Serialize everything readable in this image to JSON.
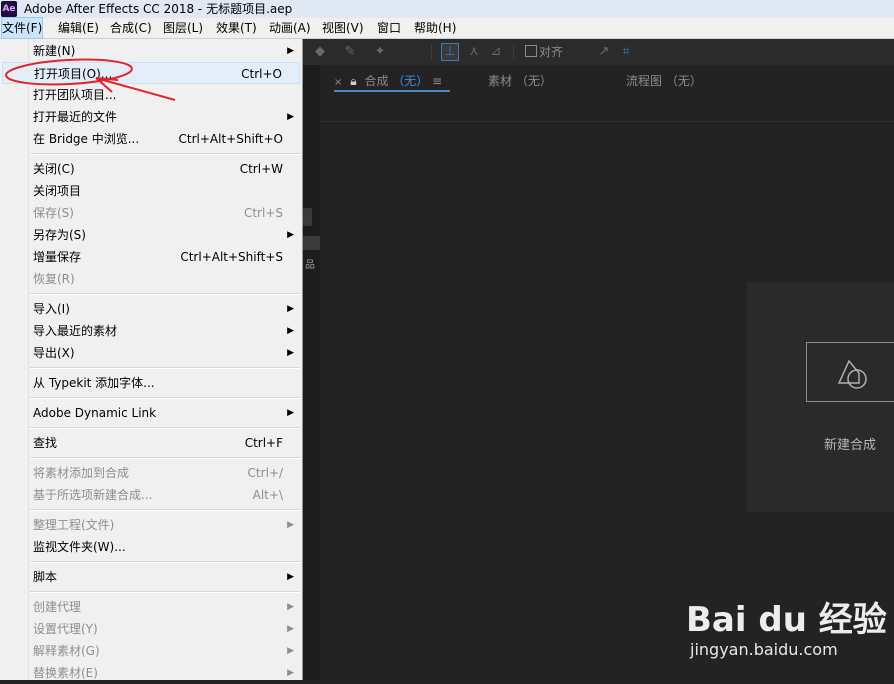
{
  "window": {
    "app_icon": "Ae",
    "title": "Adobe After Effects CC 2018 - 无标题项目.aep"
  },
  "menubar": [
    {
      "label": "文件(F)"
    },
    {
      "label": "编辑(E)"
    },
    {
      "label": "合成(C)"
    },
    {
      "label": "图层(L)"
    },
    {
      "label": "效果(T)"
    },
    {
      "label": "动画(A)"
    },
    {
      "label": "视图(V)"
    },
    {
      "label": "窗口"
    },
    {
      "label": "帮助(H)"
    }
  ],
  "toolbar": {
    "snap_label": "对齐"
  },
  "panel_tabs": [
    {
      "label": "合成",
      "paren": "（无）"
    },
    {
      "label": "素材",
      "paren": "（无）"
    },
    {
      "label": "流程图",
      "paren": "（无）"
    }
  ],
  "new_composition": {
    "label": "新建合成"
  },
  "file_menu": [
    {
      "label": "新建(N)",
      "shortcut": "",
      "submenu": true,
      "disabled": false
    },
    {
      "label": "打开项目(O)...",
      "shortcut": "Ctrl+O",
      "submenu": false,
      "disabled": false
    },
    {
      "label": "打开团队项目...",
      "shortcut": "",
      "submenu": false,
      "disabled": false
    },
    {
      "label": "打开最近的文件",
      "shortcut": "",
      "submenu": true,
      "disabled": false
    },
    {
      "label": "在 Bridge 中浏览...",
      "shortcut": "Ctrl+Alt+Shift+O",
      "submenu": false,
      "disabled": false
    },
    {
      "label": "关闭(C)",
      "shortcut": "Ctrl+W",
      "submenu": false,
      "disabled": false
    },
    {
      "label": "关闭项目",
      "shortcut": "",
      "submenu": false,
      "disabled": false
    },
    {
      "label": "保存(S)",
      "shortcut": "Ctrl+S",
      "submenu": false,
      "disabled": true
    },
    {
      "label": "另存为(S)",
      "shortcut": "",
      "submenu": true,
      "disabled": false
    },
    {
      "label": "增量保存",
      "shortcut": "Ctrl+Alt+Shift+S",
      "submenu": false,
      "disabled": false
    },
    {
      "label": "恢复(R)",
      "shortcut": "",
      "submenu": false,
      "disabled": true
    },
    {
      "label": "导入(I)",
      "shortcut": "",
      "submenu": true,
      "disabled": false
    },
    {
      "label": "导入最近的素材",
      "shortcut": "",
      "submenu": true,
      "disabled": false
    },
    {
      "label": "导出(X)",
      "shortcut": "",
      "submenu": true,
      "disabled": false
    },
    {
      "label": "从 Typekit 添加字体...",
      "shortcut": "",
      "submenu": false,
      "disabled": false
    },
    {
      "label": "Adobe Dynamic Link",
      "shortcut": "",
      "submenu": true,
      "disabled": false
    },
    {
      "label": "查找",
      "shortcut": "Ctrl+F",
      "submenu": false,
      "disabled": false
    },
    {
      "label": "将素材添加到合成",
      "shortcut": "Ctrl+/",
      "submenu": false,
      "disabled": true
    },
    {
      "label": "基于所选项新建合成...",
      "shortcut": "Alt+\\",
      "submenu": false,
      "disabled": true
    },
    {
      "label": "整理工程(文件)",
      "shortcut": "",
      "submenu": true,
      "disabled": true
    },
    {
      "label": "监视文件夹(W)...",
      "shortcut": "",
      "submenu": false,
      "disabled": false
    },
    {
      "label": "脚本",
      "shortcut": "",
      "submenu": true,
      "disabled": false
    },
    {
      "label": "创建代理",
      "shortcut": "",
      "submenu": true,
      "disabled": true
    },
    {
      "label": "设置代理(Y)",
      "shortcut": "",
      "submenu": true,
      "disabled": true
    },
    {
      "label": "解释素材(G)",
      "shortcut": "",
      "submenu": true,
      "disabled": true
    },
    {
      "label": "替换素材(E)",
      "shortcut": "",
      "submenu": true,
      "disabled": true
    }
  ],
  "annotation_color": "#e0262b",
  "watermark": {
    "logo": "Bai du 经验",
    "url": "jingyan.baidu.com"
  }
}
